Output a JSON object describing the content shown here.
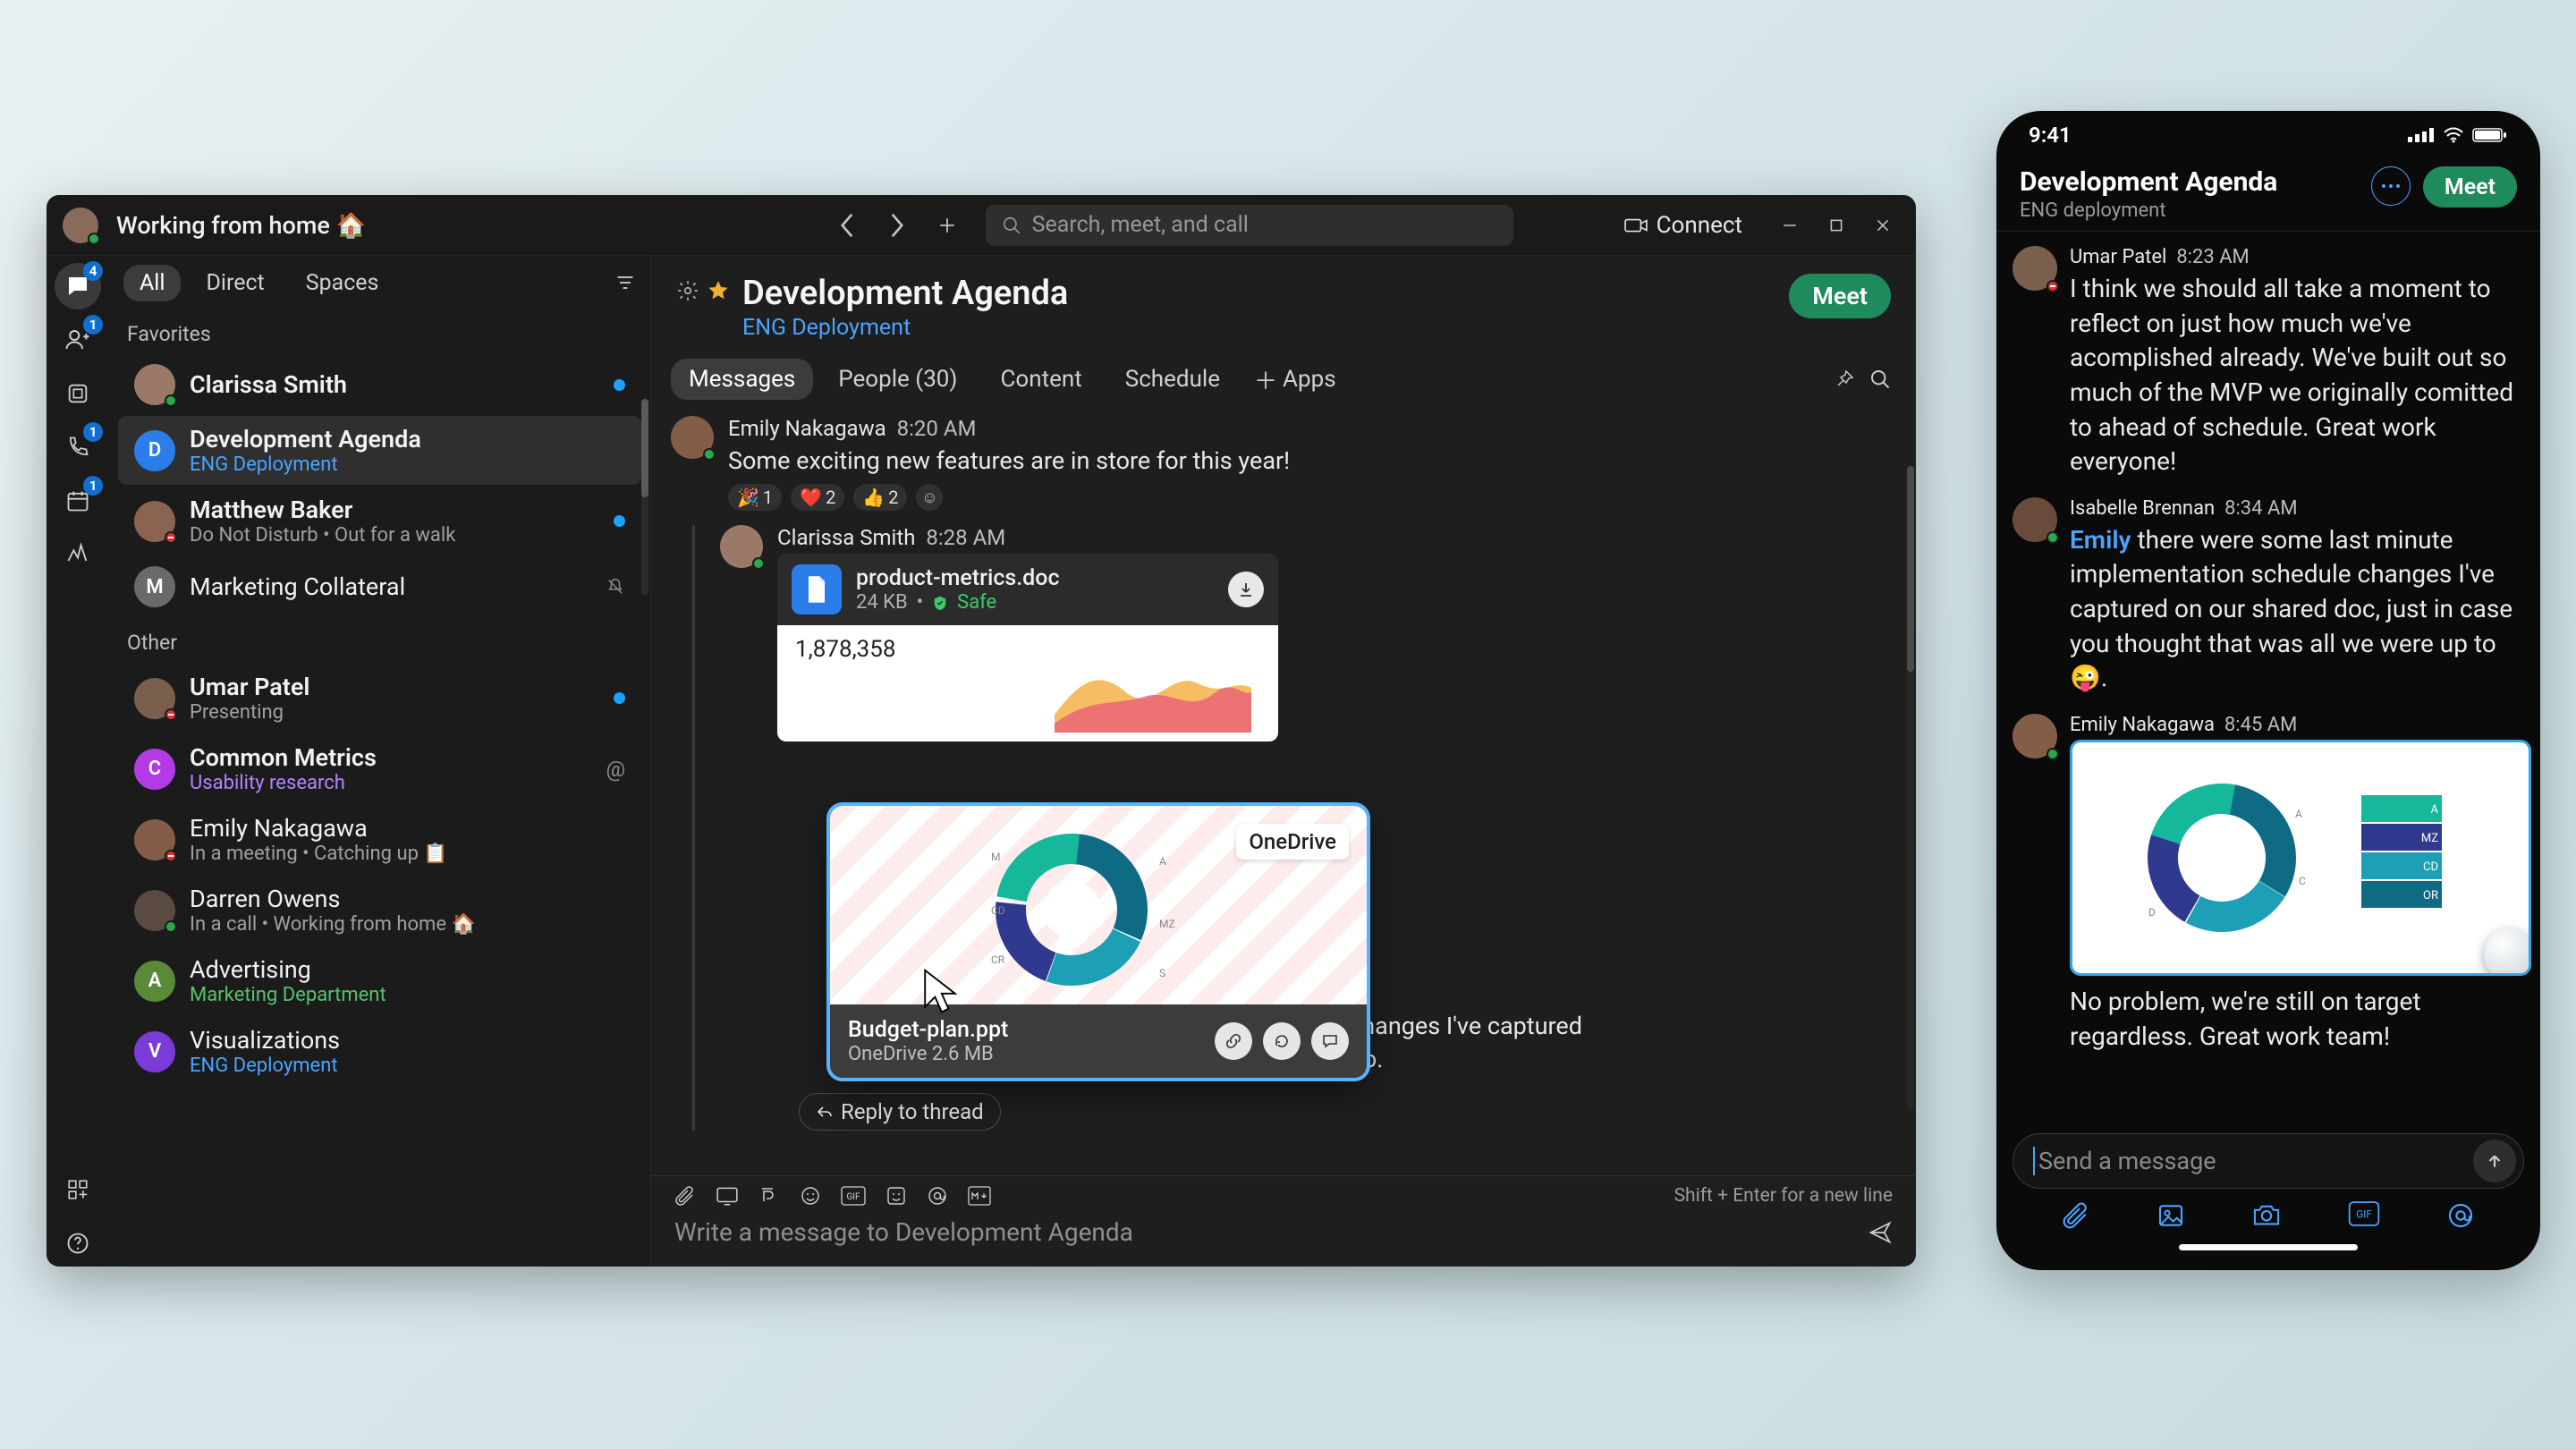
{
  "titlebar": {
    "status": "Working from home 🏠",
    "search_placeholder": "Search, meet, and call",
    "connect": "Connect"
  },
  "rail": {
    "badges": {
      "messages": "4",
      "contacts": "1",
      "calls": "1",
      "calendar": "1"
    }
  },
  "filters": {
    "all": "All",
    "direct": "Direct",
    "spaces": "Spaces",
    "section_favorites": "Favorites",
    "section_other": "Other"
  },
  "chats": [
    {
      "title": "Clarissa Smith",
      "sub": "",
      "color": "#9a7a66",
      "presence": "active",
      "right": "unread",
      "bold": true
    },
    {
      "title": "Development Agenda",
      "sub": "ENG Deployment",
      "subClass": "accent",
      "color": "#2b7de9",
      "initial": "D",
      "selected": true,
      "bold": true
    },
    {
      "title": "Matthew Baker",
      "sub": "Do Not Disturb  •  Out for a walk",
      "color": "#8a6450",
      "presence": "dnd",
      "right": "unread",
      "bold": true
    },
    {
      "title": "Marketing Collateral",
      "sub": "",
      "color": "#6a6a6a",
      "initial": "M",
      "right": "muted"
    },
    {
      "section": "Other"
    },
    {
      "title": "Umar Patel",
      "sub": "Presenting",
      "color": "#7a604c",
      "presence": "dnd",
      "right": "unread",
      "bold": true
    },
    {
      "title": "Common Metrics",
      "sub": "Usability research",
      "subClass": "purple",
      "color": "#b23be5",
      "initial": "C",
      "right": "mention",
      "bold": true
    },
    {
      "title": "Emily Nakagawa",
      "sub": "In a meeting  •  Catching up 📋",
      "color": "#845d48",
      "presence": "dnd"
    },
    {
      "title": "Darren Owens",
      "sub": "In a call  •  Working from home 🏠",
      "color": "#5a4a40",
      "presence": "active"
    },
    {
      "title": "Advertising",
      "sub": "Marketing Department",
      "subClass": "green",
      "color": "#5a8a38",
      "initial": "A"
    },
    {
      "title": "Visualizations",
      "sub": "ENG Deployment",
      "subClass": "accent",
      "color": "#7b3bd8",
      "initial": "V"
    }
  ],
  "conversation": {
    "title": "Development Agenda",
    "subtitle": "ENG Deployment",
    "meet": "Meet",
    "tabs": {
      "messages": "Messages",
      "people": "People (30)",
      "content": "Content",
      "schedule": "Schedule",
      "apps": "Apps"
    },
    "msg1": {
      "author": "Emily Nakagawa",
      "time": "8:20 AM",
      "text": "Some exciting new features are in store for this year!",
      "reactions": [
        {
          "e": "🎉",
          "c": "1"
        },
        {
          "e": "❤️",
          "c": "2"
        },
        {
          "e": "👍",
          "c": "2"
        }
      ]
    },
    "msg2": {
      "author": "Clarissa Smith",
      "time": "8:28 AM",
      "file": {
        "name": "product-metrics.doc",
        "size": "24 KB",
        "safe": "Safe",
        "preview_number": "1,878,358"
      }
    },
    "msg3_tail": "tion schedule changes I've captured",
    "msg3_tail2": "ere up to.",
    "reply_thread": "Reply to thread",
    "share": {
      "provider": "OneDrive",
      "name": "Budget-plan.ppt",
      "meta": "OneDrive 2.6 MB"
    }
  },
  "composer": {
    "hint": "Shift + Enter for a new line",
    "placeholder": "Write a message to Development Agenda"
  },
  "mobile": {
    "clock": "9:41",
    "title": "Development Agenda",
    "subtitle": "ENG deployment",
    "meet": "Meet",
    "msgs": [
      {
        "author": "Umar Patel",
        "time": "8:23 AM",
        "text": "I think we should all take a moment to reflect on just how much we've acomplished already. We've built out so much of the MVP we originally comitted to ahead of schedule. Great work everyone!"
      },
      {
        "author": "Isabelle Brennan",
        "time": "8:34 AM",
        "html": "<span class='link'>Emily</span> there were some last minute implementation schedule changes I've captured on our shared doc, just in case you thought that was all we were up to 😜."
      },
      {
        "author": "Emily Nakagawa",
        "time": "8:45 AM",
        "caption1": "No problem, we're still on target",
        "caption2": "regardless. Great work team!"
      }
    ],
    "input_placeholder": "Send a message"
  }
}
